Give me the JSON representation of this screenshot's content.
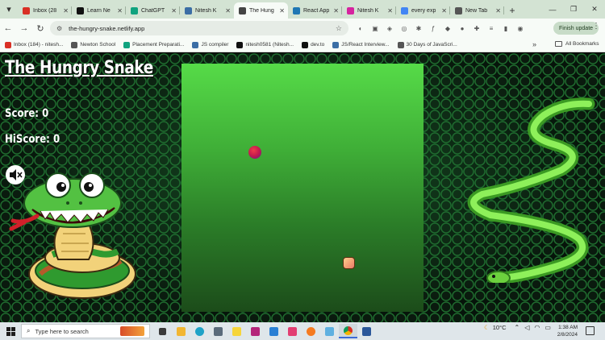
{
  "browser": {
    "tabs": [
      {
        "label": "Inbox (28",
        "color": "#d93025"
      },
      {
        "label": "Learn Ne",
        "color": "#111111"
      },
      {
        "label": "ChatGPT",
        "color": "#10a37f"
      },
      {
        "label": "Nitesh K",
        "color": "#3b6ea5"
      },
      {
        "label": "The Hung",
        "color": "#444444"
      },
      {
        "label": "React App",
        "color": "#1f77b4"
      },
      {
        "label": "Nitesh K",
        "color": "#d6249f"
      },
      {
        "label": "every exp",
        "color": "#4285f4"
      },
      {
        "label": "New Tab",
        "color": "#555555"
      }
    ],
    "active_tab_index": 4,
    "new_tab_symbol": "+",
    "url": "the-hungry-snake.netlify.app",
    "finish_update_label": "Finish update",
    "bookmarks": [
      {
        "label": "Inbox (184) - nitesh...",
        "color": "#d93025"
      },
      {
        "label": "Newton School",
        "color": "#555555"
      },
      {
        "label": "Placement Preparati...",
        "color": "#10a37f"
      },
      {
        "label": "JS compiler",
        "color": "#3b6ea5"
      },
      {
        "label": "nitesh0581 (Nitesh...",
        "color": "#111111"
      },
      {
        "label": "dev.to",
        "color": "#111111"
      },
      {
        "label": "JS/React Interview...",
        "color": "#3b6ea5"
      },
      {
        "label": "30 Days of JavaScri...",
        "color": "#555555"
      }
    ],
    "more_bookmarks_symbol": "»",
    "all_bookmarks_label": "All Bookmarks"
  },
  "game": {
    "title": "The Hungry Snake",
    "score_label": "Score: 0",
    "hiscore_label": "HiScore: 0"
  },
  "taskbar": {
    "search_placeholder": "Type here to search",
    "temperature": "10°C",
    "time": "1:38 AM",
    "date": "2/8/2024"
  }
}
